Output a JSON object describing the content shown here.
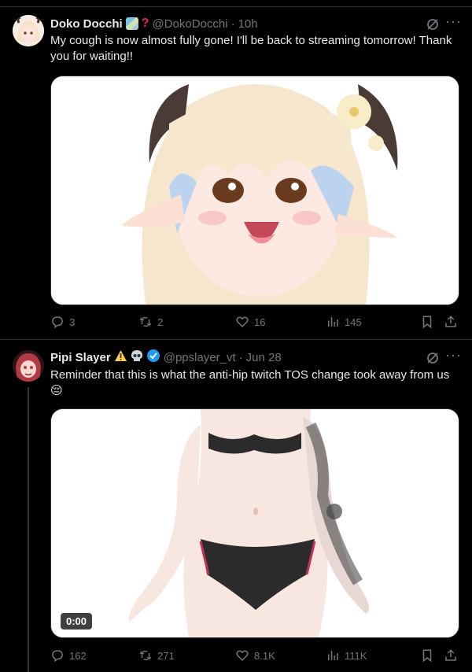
{
  "tweets": [
    {
      "name": "Doko Docchi",
      "handle": "@DokoDocchi",
      "sep": "·",
      "time": "10h",
      "text": "My cough is now almost fully gone! I'll be back to streaming tomorrow! Thank you for waiting!!",
      "replies": "3",
      "retweets": "2",
      "likes": "16",
      "views": "145"
    },
    {
      "name": "Pipi Slayer",
      "handle": "@ppslayer_vt",
      "sep": "·",
      "time": "Jun 28",
      "text": "Reminder that this is what the anti-hip twitch TOS change took away from us😔",
      "replies": "162",
      "retweets": "271",
      "likes": "8.1K",
      "views": "111K",
      "video_duration": "0:00"
    }
  ],
  "colors": {
    "background": "#000000",
    "text": "#e7e9ea",
    "muted": "#71767b",
    "border": "#2f3336",
    "verified": "#1d9bf0"
  },
  "icons": {
    "reply": "reply-icon",
    "retweet": "retweet-icon",
    "like": "like-icon",
    "views": "views-icon",
    "bookmark": "bookmark-icon",
    "share": "share-icon",
    "grok": "grok-icon",
    "more": "more-icon"
  }
}
